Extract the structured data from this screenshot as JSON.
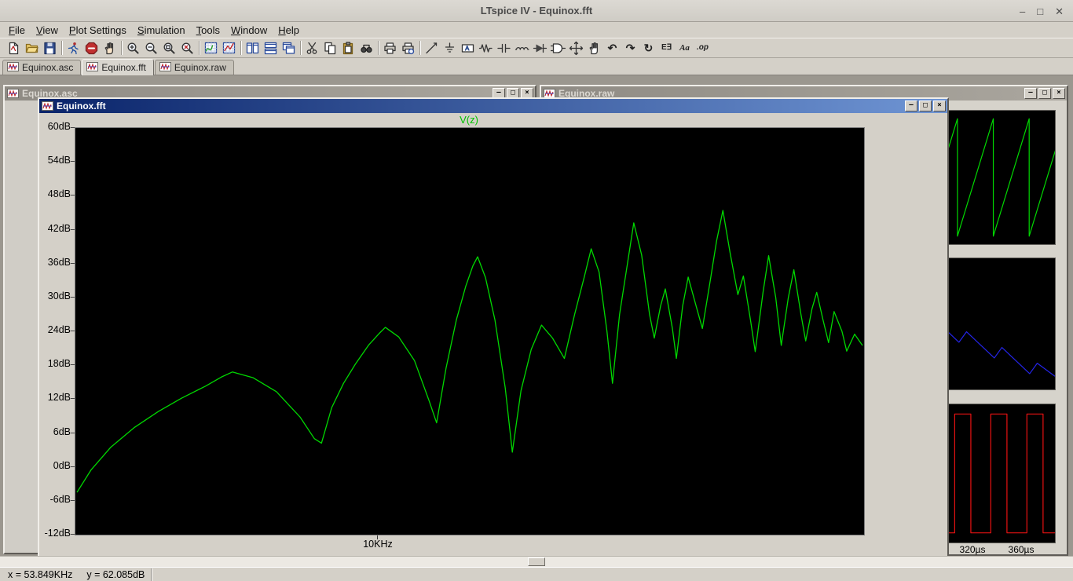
{
  "app": {
    "title": "LTspice IV - Equinox.fft",
    "window_buttons": {
      "minimize": "–",
      "maximize": "□",
      "close": "✕"
    }
  },
  "menu": {
    "items": [
      "File",
      "View",
      "Plot Settings",
      "Simulation",
      "Tools",
      "Window",
      "Help"
    ]
  },
  "toolbar": {
    "buttons": [
      {
        "name": "new-schematic",
        "icon": "new-schematic"
      },
      {
        "name": "open-file",
        "icon": "open"
      },
      {
        "name": "save",
        "icon": "save"
      },
      {
        "sep": true
      },
      {
        "name": "run",
        "icon": "run"
      },
      {
        "name": "halt",
        "icon": "halt"
      },
      {
        "name": "pan",
        "icon": "hand"
      },
      {
        "sep": true
      },
      {
        "name": "zoom-area",
        "icon": "zoom-in"
      },
      {
        "name": "zoom-back",
        "icon": "zoom-out"
      },
      {
        "name": "zoom-full-extents",
        "icon": "zoom-full"
      },
      {
        "name": "zoom-reset",
        "icon": "zoom-reset"
      },
      {
        "sep": true
      },
      {
        "name": "autorange-y-axis",
        "icon": "autorange"
      },
      {
        "name": "plot-settings",
        "icon": "plot-settings"
      },
      {
        "sep": true
      },
      {
        "name": "tile-vertically",
        "icon": "tile-vert"
      },
      {
        "name": "tile-horizontally",
        "icon": "tile-horz"
      },
      {
        "name": "cascade-windows",
        "icon": "cascade"
      },
      {
        "sep": true
      },
      {
        "name": "cut",
        "icon": "cut"
      },
      {
        "name": "copy",
        "icon": "copy"
      },
      {
        "name": "paste",
        "icon": "paste"
      },
      {
        "name": "find",
        "icon": "find"
      },
      {
        "sep": true
      },
      {
        "name": "print",
        "icon": "print"
      },
      {
        "name": "print-preview",
        "icon": "print-preview"
      },
      {
        "sep": true
      },
      {
        "name": "draw-wire",
        "icon": "wire"
      },
      {
        "name": "place-ground",
        "icon": "ground"
      },
      {
        "name": "label-net",
        "icon": "label-net"
      },
      {
        "name": "place-resistor",
        "icon": "resistor"
      },
      {
        "name": "place-capacitor",
        "icon": "capacitor"
      },
      {
        "name": "place-inductor",
        "icon": "inductor"
      },
      {
        "name": "place-diode",
        "icon": "diode"
      },
      {
        "name": "place-component",
        "icon": "component"
      },
      {
        "name": "move",
        "icon": "move"
      },
      {
        "name": "drag",
        "icon": "drag"
      },
      {
        "name": "undo",
        "glyph": "↶"
      },
      {
        "name": "redo",
        "glyph": "↷"
      },
      {
        "name": "rotate",
        "glyph": "↻"
      },
      {
        "name": "mirror",
        "glyph": "E∃"
      },
      {
        "name": "text",
        "glyph": "Aa"
      },
      {
        "name": "spice-directive",
        "glyph": ".op"
      }
    ]
  },
  "tabs": [
    {
      "label": "Equinox.asc",
      "active": false
    },
    {
      "label": "Equinox.fft",
      "active": true
    },
    {
      "label": "Equinox.raw",
      "active": false
    }
  ],
  "win_buttons": [
    "–",
    "□",
    "×"
  ],
  "windows": {
    "asc": {
      "title": "Equinox.asc"
    },
    "raw": {
      "title": "Equinox.raw",
      "time_labels": [
        "320µs",
        "360µs"
      ]
    },
    "fft": {
      "title": "Equinox.fft",
      "trace_label": "V(z)",
      "x_tick": "10KHz",
      "y_ticks": [
        "60dB",
        "54dB",
        "48dB",
        "42dB",
        "36dB",
        "30dB",
        "24dB",
        "18dB",
        "12dB",
        "6dB",
        "0dB",
        "-6dB",
        "-12dB"
      ]
    }
  },
  "status_bar": {
    "x": "x = 53.849KHz",
    "y": "y = 62.085dB"
  },
  "colors": {
    "trace_green": "#00d800",
    "trace_blue": "#2424e8",
    "trace_red": "#e81212",
    "plot_bg": "#000000",
    "active_title": "#0a246a"
  },
  "chart_data": [
    {
      "type": "line",
      "panel": "Equinox.fft",
      "title": "V(z)",
      "x_axis": {
        "scale": "log-frequency",
        "labeled_tick": "10KHz",
        "labeled_tick_fraction": 0.383
      },
      "y_axis": {
        "unit": "dB",
        "min": -12,
        "max": 60,
        "tick_step": 6
      },
      "legend": "none",
      "grid": false,
      "series": [
        {
          "name": "V(z)",
          "color": "#00d800",
          "points_xfrac_dB": [
            [
              0.002,
              -4.5
            ],
            [
              0.02,
              -0.5
            ],
            [
              0.045,
              3.5
            ],
            [
              0.075,
              7
            ],
            [
              0.105,
              9.8
            ],
            [
              0.135,
              12.2
            ],
            [
              0.165,
              14.3
            ],
            [
              0.185,
              15.9
            ],
            [
              0.199,
              16.8
            ],
            [
              0.225,
              15.8
            ],
            [
              0.255,
              13.3
            ],
            [
              0.285,
              8.8
            ],
            [
              0.303,
              5
            ],
            [
              0.312,
              4.2
            ],
            [
              0.325,
              10.5
            ],
            [
              0.34,
              14.8
            ],
            [
              0.355,
              18.2
            ],
            [
              0.372,
              21.6
            ],
            [
              0.385,
              23.6
            ],
            [
              0.393,
              24.7
            ],
            [
              0.41,
              23
            ],
            [
              0.43,
              18.8
            ],
            [
              0.449,
              11.5
            ],
            [
              0.458,
              7.8
            ],
            [
              0.47,
              17.5
            ],
            [
              0.483,
              26
            ],
            [
              0.495,
              32
            ],
            [
              0.504,
              35.6
            ],
            [
              0.51,
              37.2
            ],
            [
              0.52,
              33.5
            ],
            [
              0.532,
              26
            ],
            [
              0.545,
              14
            ],
            [
              0.554,
              2.6
            ],
            [
              0.565,
              13.5
            ],
            [
              0.578,
              20.8
            ],
            [
              0.591,
              25.1
            ],
            [
              0.605,
              22.8
            ],
            [
              0.62,
              19.2
            ],
            [
              0.633,
              27
            ],
            [
              0.645,
              33.5
            ],
            [
              0.654,
              38.6
            ],
            [
              0.664,
              34.5
            ],
            [
              0.674,
              24
            ],
            [
              0.681,
              14.8
            ],
            [
              0.69,
              27
            ],
            [
              0.7,
              36
            ],
            [
              0.708,
              43.2
            ],
            [
              0.718,
              37.5
            ],
            [
              0.728,
              27
            ],
            [
              0.734,
              22.8
            ],
            [
              0.742,
              28.5
            ],
            [
              0.748,
              31.5
            ],
            [
              0.757,
              24.5
            ],
            [
              0.762,
              19.2
            ],
            [
              0.77,
              28.5
            ],
            [
              0.777,
              33.6
            ],
            [
              0.788,
              28
            ],
            [
              0.795,
              24.5
            ],
            [
              0.805,
              33
            ],
            [
              0.813,
              40
            ],
            [
              0.821,
              45.4
            ],
            [
              0.83,
              38
            ],
            [
              0.84,
              30.5
            ],
            [
              0.847,
              33.8
            ],
            [
              0.856,
              26
            ],
            [
              0.862,
              20.4
            ],
            [
              0.872,
              31
            ],
            [
              0.879,
              37.4
            ],
            [
              0.888,
              30
            ],
            [
              0.895,
              21.5
            ],
            [
              0.904,
              30
            ],
            [
              0.911,
              34.9
            ],
            [
              0.92,
              27
            ],
            [
              0.926,
              22.3
            ],
            [
              0.934,
              28
            ],
            [
              0.94,
              30.9
            ],
            [
              0.948,
              26
            ],
            [
              0.955,
              22
            ],
            [
              0.962,
              27.5
            ],
            [
              0.972,
              24
            ],
            [
              0.978,
              20.5
            ],
            [
              0.988,
              23.5
            ],
            [
              0.998,
              21.5
            ]
          ]
        }
      ]
    },
    {
      "type": "line",
      "panel": "Equinox.raw top pane",
      "name": "rising sawtooth trace",
      "color": "#00d800",
      "pattern": {
        "kind": "rising-sawtooth",
        "period_fraction": 0.071,
        "phase_offset": -0.045,
        "low_norm": 0.94,
        "high_norm": 0.06
      }
    },
    {
      "type": "line",
      "panel": "Equinox.raw middle pane",
      "name": "descending ramp trace",
      "color": "#2424e8",
      "points_norm": [
        [
          0,
          0.5
        ],
        [
          0.05,
          0.7
        ],
        [
          0.065,
          0.62
        ],
        [
          0.12,
          0.82
        ],
        [
          0.133,
          0.88
        ],
        [
          0.136,
          0.08
        ],
        [
          0.19,
          0.28
        ],
        [
          0.205,
          0.2
        ],
        [
          0.26,
          0.4
        ],
        [
          0.275,
          0.32
        ],
        [
          0.33,
          0.52
        ],
        [
          0.345,
          0.44
        ],
        [
          0.4,
          0.64
        ],
        [
          0.415,
          0.56
        ],
        [
          0.47,
          0.76
        ],
        [
          0.485,
          0.68
        ],
        [
          0.54,
          0.88
        ],
        [
          0.543,
          0.08
        ],
        [
          0.6,
          0.28
        ],
        [
          0.615,
          0.2
        ],
        [
          0.67,
          0.4
        ],
        [
          0.685,
          0.32
        ],
        [
          0.74,
          0.52
        ],
        [
          0.755,
          0.44
        ],
        [
          0.81,
          0.64
        ],
        [
          0.825,
          0.56
        ],
        [
          0.88,
          0.76
        ],
        [
          0.895,
          0.68
        ],
        [
          0.95,
          0.88
        ],
        [
          0.965,
          0.8
        ],
        [
          1,
          0.9
        ]
      ]
    },
    {
      "type": "line",
      "panel": "Equinox.raw bottom pane",
      "name": "square wave trace",
      "color": "#e81212",
      "pattern": {
        "kind": "square",
        "period_fraction": 0.0715,
        "high_width_fraction": 0.032,
        "first_rise_fraction": 0.015,
        "low_norm": 0.93,
        "high_norm": 0.07
      },
      "x_tick_labels": [
        "320µs",
        "360µs"
      ]
    }
  ]
}
